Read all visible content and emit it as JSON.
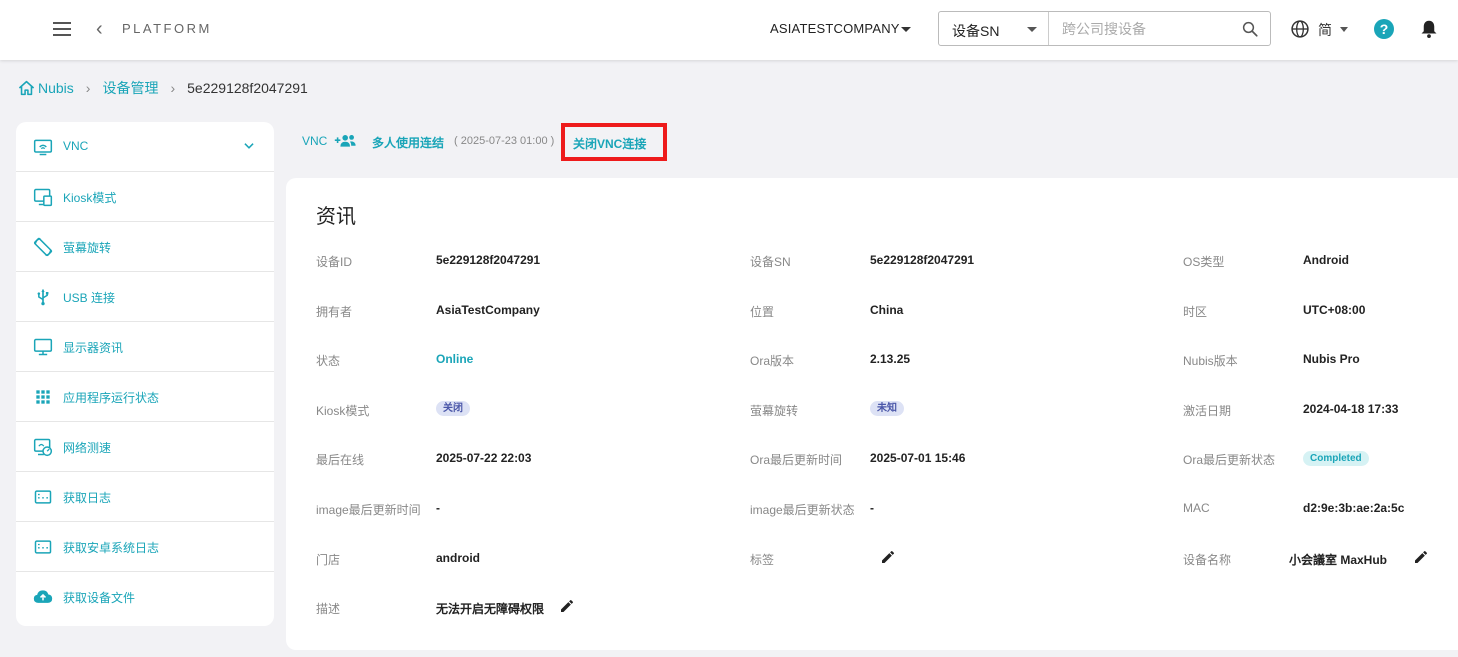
{
  "header": {
    "platform": "PLATFORM",
    "company": "ASIATESTCOMPANY",
    "search_type": "设备SN",
    "search_placeholder": "跨公司搜设备",
    "language": "简"
  },
  "breadcrumb": {
    "home": "Nubis",
    "section": "设备管理",
    "current": "5e229128f2047291"
  },
  "sidebar": {
    "items": [
      {
        "label": "VNC",
        "icon": "vnc-icon"
      },
      {
        "label": "Kiosk模式",
        "icon": "kiosk-icon"
      },
      {
        "label": "萤幕旋转",
        "icon": "screen-rotation-icon"
      },
      {
        "label": "USB 连接",
        "icon": "usb-icon"
      },
      {
        "label": "显示器资讯",
        "icon": "monitor-icon"
      },
      {
        "label": "应用程序运行状态",
        "icon": "apps-grid-icon"
      },
      {
        "label": "网络测速",
        "icon": "network-speed-icon"
      },
      {
        "label": "获取日志",
        "icon": "log-icon"
      },
      {
        "label": "获取安卓系统日志",
        "icon": "android-log-icon"
      },
      {
        "label": "获取设备文件",
        "icon": "cloud-upload-icon"
      }
    ]
  },
  "vnc_bar": {
    "vnc_label": "VNC",
    "multi_label": "多人使用连结",
    "time": "( 2025-07-23 01:00 )",
    "close_label": "关闭VNC连接"
  },
  "info": {
    "title": "资讯",
    "device_id_label": "设备ID",
    "device_id": "5e229128f2047291",
    "device_sn_label": "设备SN",
    "device_sn": "5e229128f2047291",
    "os_label": "OS类型",
    "os": "Android",
    "owner_label": "拥有者",
    "owner": "AsiaTestCompany",
    "location_label": "位置",
    "location": "China",
    "timezone_label": "时区",
    "timezone": "UTC+08:00",
    "status_label": "状态",
    "status": "Online",
    "ora_version_label": "Ora版本",
    "ora_version": "2.13.25",
    "nubis_version_label": "Nubis版本",
    "nubis_version": "Nubis Pro",
    "kiosk_label": "Kiosk模式",
    "kiosk": "关闭",
    "rotation_label": "萤幕旋转",
    "rotation": "未知",
    "activation_label": "激活日期",
    "activation": "2024-04-18 17:33",
    "last_online_label": "最后在线",
    "last_online": "2025-07-22 22:03",
    "ora_update_time_label": "Ora最后更新时间",
    "ora_update_time": "2025-07-01 15:46",
    "ora_update_status_label": "Ora最后更新状态",
    "ora_update_status": "Completed",
    "image_update_time_label": "image最后更新时间",
    "image_update_time": "-",
    "image_update_status_label": "image最后更新状态",
    "image_update_status": "-",
    "mac_label": "MAC",
    "mac": "d2:9e:3b:ae:2a:5c",
    "store_label": "门店",
    "store": "android",
    "tags_label": "标签",
    "device_name_label": "设备名称",
    "device_name": "小会議室 MaxHub",
    "description_label": "描述",
    "description": "无法开启无障碍权限"
  },
  "colors": {
    "accent": "#1aa5b8",
    "highlight": "#ee1b1b"
  }
}
